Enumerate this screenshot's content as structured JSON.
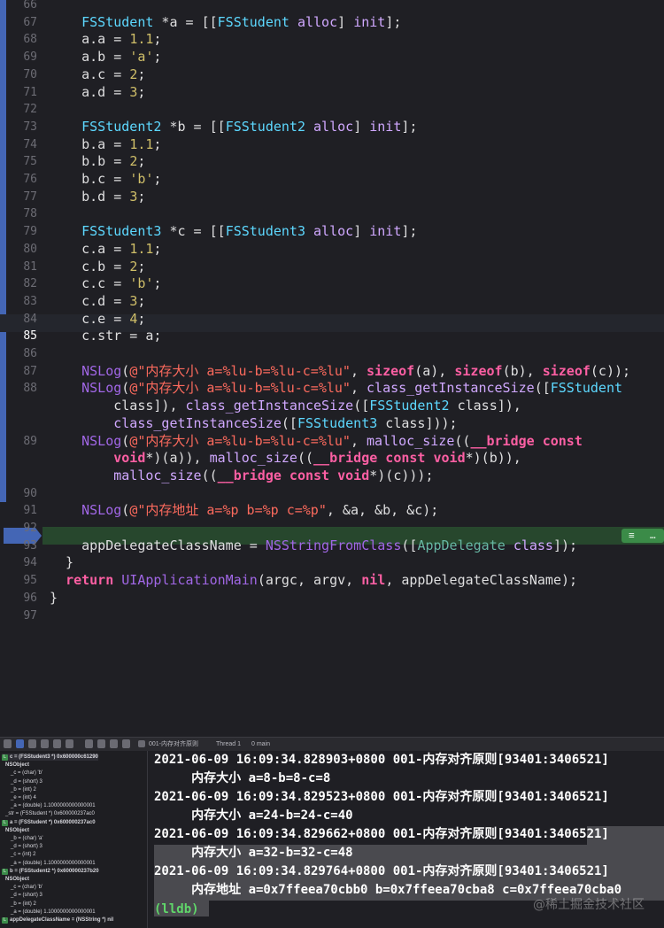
{
  "editor": {
    "lines": [
      {
        "n": "66",
        "tokens": []
      },
      {
        "n": "67",
        "tokens": [
          [
            "    ",
            ""
          ],
          [
            "FSStudent",
            "cl"
          ],
          [
            " *a = [[",
            ""
          ],
          [
            "FSStudent",
            "cl"
          ],
          [
            " ",
            ""
          ],
          [
            "alloc",
            "ty"
          ],
          [
            "] ",
            ""
          ],
          [
            "init",
            "ty"
          ],
          [
            "];",
            ""
          ]
        ]
      },
      {
        "n": "68",
        "tokens": [
          [
            "    a.a = ",
            ""
          ],
          [
            "1.1",
            "nm"
          ],
          [
            ";",
            ""
          ]
        ]
      },
      {
        "n": "69",
        "tokens": [
          [
            "    a.b = ",
            ""
          ],
          [
            "'a'",
            "nm"
          ],
          [
            ";",
            ""
          ]
        ]
      },
      {
        "n": "70",
        "tokens": [
          [
            "    a.c = ",
            ""
          ],
          [
            "2",
            "nm"
          ],
          [
            ";",
            ""
          ]
        ]
      },
      {
        "n": "71",
        "tokens": [
          [
            "    a.d = ",
            ""
          ],
          [
            "3",
            "nm"
          ],
          [
            ";",
            ""
          ]
        ]
      },
      {
        "n": "72",
        "tokens": []
      },
      {
        "n": "73",
        "tokens": [
          [
            "    ",
            ""
          ],
          [
            "FSStudent2",
            "cl"
          ],
          [
            " *b = [[",
            ""
          ],
          [
            "FSStudent2",
            "cl"
          ],
          [
            " ",
            ""
          ],
          [
            "alloc",
            "ty"
          ],
          [
            "] ",
            ""
          ],
          [
            "init",
            "ty"
          ],
          [
            "];",
            ""
          ]
        ]
      },
      {
        "n": "74",
        "tokens": [
          [
            "    b.a = ",
            ""
          ],
          [
            "1.1",
            "nm"
          ],
          [
            ";",
            ""
          ]
        ]
      },
      {
        "n": "75",
        "tokens": [
          [
            "    b.b = ",
            ""
          ],
          [
            "2",
            "nm"
          ],
          [
            ";",
            ""
          ]
        ]
      },
      {
        "n": "76",
        "tokens": [
          [
            "    b.c = ",
            ""
          ],
          [
            "'b'",
            "nm"
          ],
          [
            ";",
            ""
          ]
        ]
      },
      {
        "n": "77",
        "tokens": [
          [
            "    b.d = ",
            ""
          ],
          [
            "3",
            "nm"
          ],
          [
            ";",
            ""
          ]
        ]
      },
      {
        "n": "78",
        "tokens": []
      },
      {
        "n": "79",
        "tokens": [
          [
            "    ",
            ""
          ],
          [
            "FSStudent3",
            "cl"
          ],
          [
            " *c = [[",
            ""
          ],
          [
            "FSStudent3",
            "cl"
          ],
          [
            " ",
            ""
          ],
          [
            "alloc",
            "ty"
          ],
          [
            "] ",
            ""
          ],
          [
            "init",
            "ty"
          ],
          [
            "];",
            ""
          ]
        ]
      },
      {
        "n": "80",
        "tokens": [
          [
            "    c.a = ",
            ""
          ],
          [
            "1.1",
            "nm"
          ],
          [
            ";",
            ""
          ]
        ]
      },
      {
        "n": "81",
        "tokens": [
          [
            "    c.b = ",
            ""
          ],
          [
            "2",
            "nm"
          ],
          [
            ";",
            ""
          ]
        ]
      },
      {
        "n": "82",
        "tokens": [
          [
            "    c.c = ",
            ""
          ],
          [
            "'b'",
            "nm"
          ],
          [
            ";",
            ""
          ]
        ]
      },
      {
        "n": "83",
        "tokens": [
          [
            "    c.d = ",
            ""
          ],
          [
            "3",
            "nm"
          ],
          [
            ";",
            ""
          ]
        ]
      },
      {
        "n": "84",
        "tokens": [
          [
            "    c.e = ",
            ""
          ],
          [
            "4",
            "nm"
          ],
          [
            ";",
            ""
          ]
        ]
      },
      {
        "n": "85",
        "tokens": [
          [
            "    c.str = a;",
            ""
          ]
        ],
        "current": true
      },
      {
        "n": "86",
        "tokens": []
      },
      {
        "n": "87",
        "tokens": [
          [
            "    ",
            ""
          ],
          [
            "NSLog",
            "fn"
          ],
          [
            "(",
            ""
          ],
          [
            "@\"内存大小 a=%lu-b=%lu-c=%lu\"",
            "st"
          ],
          [
            ", ",
            ""
          ],
          [
            "sizeof",
            "kw"
          ],
          [
            "(a), ",
            ""
          ],
          [
            "sizeof",
            "kw"
          ],
          [
            "(b), ",
            ""
          ],
          [
            "sizeof",
            "kw"
          ],
          [
            "(c));",
            ""
          ]
        ]
      },
      {
        "n": "88",
        "tokens": [
          [
            "    ",
            ""
          ],
          [
            "NSLog",
            "fn"
          ],
          [
            "(",
            ""
          ],
          [
            "@\"内存大小 a=%lu-b=%lu-c=%lu\"",
            "st"
          ],
          [
            ", ",
            ""
          ],
          [
            "class_getInstanceSize",
            "ty"
          ],
          [
            "([",
            ""
          ],
          [
            "FSStudent",
            "cl"
          ]
        ]
      },
      {
        "n": "",
        "tokens": [
          [
            "        class]), ",
            ""
          ],
          [
            "class_getInstanceSize",
            "ty"
          ],
          [
            "([",
            ""
          ],
          [
            "FSStudent2",
            "cl"
          ],
          [
            " class]),",
            ""
          ]
        ]
      },
      {
        "n": "",
        "tokens": [
          [
            "        ",
            ""
          ],
          [
            "class_getInstanceSize",
            "ty"
          ],
          [
            "([",
            ""
          ],
          [
            "FSStudent3",
            "cl"
          ],
          [
            " class]));",
            ""
          ]
        ]
      },
      {
        "n": "89",
        "tokens": [
          [
            "    ",
            ""
          ],
          [
            "NSLog",
            "fn"
          ],
          [
            "(",
            ""
          ],
          [
            "@\"内存大小 a=%lu-b=%lu-c=%lu\"",
            "st"
          ],
          [
            ", ",
            ""
          ],
          [
            "malloc_size",
            "ty"
          ],
          [
            "((",
            ""
          ],
          [
            "__bridge const",
            "kw"
          ]
        ]
      },
      {
        "n": "",
        "tokens": [
          [
            "        ",
            ""
          ],
          [
            "void",
            "kw"
          ],
          [
            "*)(a)), ",
            ""
          ],
          [
            "malloc_size",
            "ty"
          ],
          [
            "((",
            ""
          ],
          [
            "__bridge const void",
            "kw"
          ],
          [
            "*)(b)),",
            ""
          ]
        ]
      },
      {
        "n": "",
        "tokens": [
          [
            "        ",
            ""
          ],
          [
            "malloc_size",
            "ty"
          ],
          [
            "((",
            ""
          ],
          [
            "__bridge const void",
            "kw"
          ],
          [
            "*)(c)));",
            ""
          ]
        ]
      },
      {
        "n": "90",
        "tokens": []
      },
      {
        "n": "91",
        "tokens": [
          [
            "    ",
            ""
          ],
          [
            "NSLog",
            "fn"
          ],
          [
            "(",
            ""
          ],
          [
            "@\"内存地址 a=%p b=%p c=%p\"",
            "st"
          ],
          [
            ", &a, &b, &c);",
            ""
          ]
        ]
      },
      {
        "n": "92",
        "tokens": []
      },
      {
        "n": "93",
        "tokens": [
          [
            "    appDelegateClassName = ",
            ""
          ],
          [
            "NSStringFromClass",
            "fn"
          ],
          [
            "([",
            ""
          ],
          [
            "AppDelegate",
            "fn2"
          ],
          [
            " ",
            ""
          ],
          [
            "class",
            "ty"
          ],
          [
            "]);",
            ""
          ]
        ],
        "breakpoint": true
      },
      {
        "n": "94",
        "tokens": [
          [
            "  }",
            ""
          ]
        ]
      },
      {
        "n": "95",
        "tokens": [
          [
            "  ",
            ""
          ],
          [
            "return",
            "kw"
          ],
          [
            " ",
            ""
          ],
          [
            "UIApplicationMain",
            "fn"
          ],
          [
            "(argc, argv, ",
            ""
          ],
          [
            "nil",
            "kw"
          ],
          [
            ", appDelegateClassName);",
            ""
          ]
        ]
      },
      {
        "n": "96",
        "tokens": [
          [
            "}",
            ""
          ]
        ]
      },
      {
        "n": "97",
        "tokens": []
      }
    ]
  },
  "debug_bar": {
    "target": "001-内存对齐原则",
    "thread": "Thread 1",
    "frame": "0 main"
  },
  "variables": [
    {
      "tag": "L",
      "text": "c = (FSStudent3 *) 0x600000c61290",
      "top": true
    },
    {
      "text": "NSObject",
      "bold": true,
      "indent": 1
    },
    {
      "text": "_c = (char) 'b'",
      "indent": 2
    },
    {
      "text": "_d = (short) 3",
      "indent": 2
    },
    {
      "text": "_b = (int) 2",
      "indent": 2
    },
    {
      "text": "_e = (int) 4",
      "indent": 2
    },
    {
      "text": "_a = (double) 1.1000000000000001",
      "indent": 2
    },
    {
      "text": "_str = (FSStudent *) 0x600000237ac0",
      "indent": 1
    },
    {
      "tag": "L",
      "text": "a = (FSStudent *) 0x600000237ac0",
      "top": true
    },
    {
      "text": "NSObject",
      "bold": true,
      "indent": 1
    },
    {
      "text": "_b = (char) 'a'",
      "indent": 2
    },
    {
      "text": "_d = (short) 3",
      "indent": 2
    },
    {
      "text": "_c = (int) 2",
      "indent": 2
    },
    {
      "text": "_a = (double) 1.1000000000000001",
      "indent": 2
    },
    {
      "tag": "L",
      "text": "b = (FSStudent2 *) 0x600000237b20",
      "top": true
    },
    {
      "text": "NSObject",
      "bold": true,
      "indent": 1
    },
    {
      "text": "_c = (char) 'b'",
      "indent": 2
    },
    {
      "text": "_d = (short) 3",
      "indent": 2
    },
    {
      "text": "_b = (int) 2",
      "indent": 2
    },
    {
      "text": "_a = (double) 1.1000000000000001",
      "indent": 2
    },
    {
      "tag": "L",
      "text": "appDelegateClassName = (NSString *) nil",
      "top": true
    }
  ],
  "console": {
    "lines": [
      "2021-06-09 16:09:34.828903+0800 001-内存对齐原则[93401:3406521]",
      "     内存大小 a=8-b=8-c=8",
      "2021-06-09 16:09:34.829523+0800 001-内存对齐原则[93401:3406521]",
      "     内存大小 a=24-b=24-c=40",
      "2021-06-09 16:09:34.829662+0800 001-内存对齐原则[93401:3406521]",
      "     内存大小 a=32-b=32-c=48",
      "2021-06-09 16:09:34.829764+0800 001-内存对齐原则[93401:3406521]",
      "     内存地址 a=0x7ffeea70cbb0 b=0x7ffeea70cba8 c=0x7ffeea70cba0"
    ],
    "prompt": "(lldb)",
    "watermark": "@稀土掘金技术社区"
  }
}
